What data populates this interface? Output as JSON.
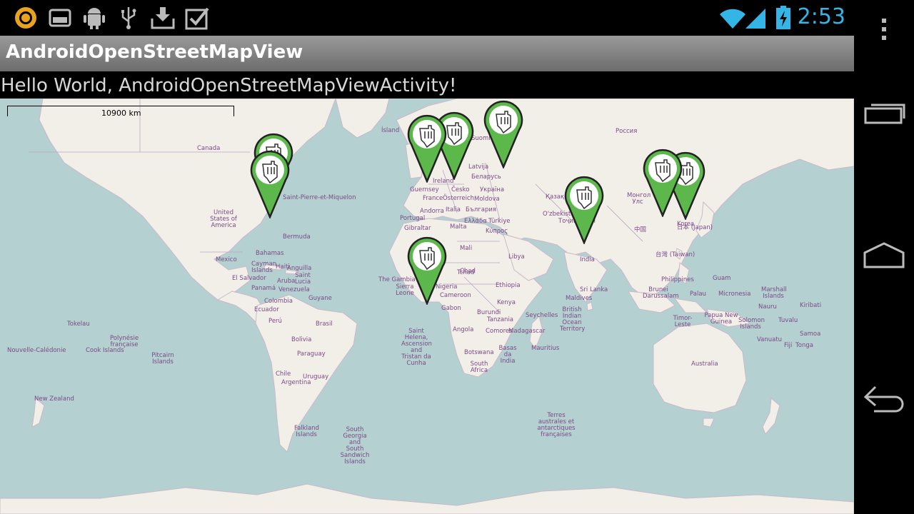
{
  "status_bar": {
    "icons": [
      "app-notification-icon",
      "storage-icon",
      "android-debug-icon",
      "usb-icon",
      "download-icon",
      "checkbox-icon"
    ],
    "right_icons": [
      "wifi-icon",
      "signal-icon",
      "battery-charging-icon"
    ],
    "time": "2:53"
  },
  "action_bar": {
    "title": "AndroidOpenStreetMapView"
  },
  "content": {
    "message": "Hello World, AndroidOpenStreetMapViewActivity!"
  },
  "map": {
    "scale_label": "10900 km",
    "marker_icon": "hand-pointer-pin-icon",
    "marker_color": "#5cb84a",
    "labels": [
      "Canada",
      "United States of America",
      "Mexico",
      "Bermuda",
      "Saint-Pierre-et-Miquelon",
      "Bahamas",
      "Cayman Islands",
      "Haiti",
      "Anguilla",
      "Saint Lucia",
      "Aruba",
      "Venezuela",
      "Guyane",
      "Panamá",
      "El Salvador",
      "Colombia",
      "Ecuador",
      "Perú",
      "Brasil",
      "Bolivia",
      "Paraguay",
      "Chile",
      "Uruguay",
      "Argentina",
      "Falkland Islands",
      "South Georgia and South Sandwich Islands",
      "Ísland",
      "Suomi",
      "Россия",
      "Latvija",
      "Беларусь",
      "Україна",
      "Moldova",
      "Ireland",
      "Guernsey",
      "France",
      "Österreich",
      "Česko",
      "Andorra",
      "Italia",
      "България",
      "Portugal",
      "Gibraltar",
      "Malta",
      "Türkiye",
      "Ελλάδα",
      "Κύπρος",
      "Қазақстан",
      "O'zbekiston",
      "Тоҷикистон",
      "Монгол Улс",
      "中国",
      "India",
      "Sri Lanka",
      "Maldives",
      "Ethiopia",
      "Kenya",
      "Tanzania",
      "Burundi",
      "Seychelles",
      "Comores",
      "Mauritius",
      "Madagascar",
      "Angola",
      "Botswana",
      "South Africa",
      "Basas da India",
      "Gabon",
      "Cameroon",
      "Nigeria",
      "Tchad",
      "Sierra Leone",
      "The Gambia",
      "Saint Helena, Ascension and Tristan da Cunha",
      "British Indian Ocean Territory",
      "Terres australes et antarctiques françaises",
      "Australia",
      "Philippines",
      "Guam",
      "Palau",
      "Micronesia",
      "Marshall Islands",
      "Nauru",
      "Kiribati",
      "Tuvalu",
      "Solomon Islands",
      "Papua New Guinea",
      "Timor-Leste",
      "Brunei Darussalam",
      "Vanuatu",
      "Fiji",
      "Tonga",
      "Samoa",
      "Tokelau",
      "Cook Islands",
      "Polynésie française",
      "Pitcairn Islands",
      "Nouvelle-Calédonie",
      "New Zealand",
      "日本 (Japan)",
      "台灣 (Taiwan)",
      "Korea",
      "Mali",
      "Libya",
      "Chad"
    ]
  },
  "nav_bar": {
    "menu_icon": "overflow-menu-icon",
    "buttons": [
      "recent-apps-icon",
      "home-icon",
      "back-icon"
    ]
  }
}
